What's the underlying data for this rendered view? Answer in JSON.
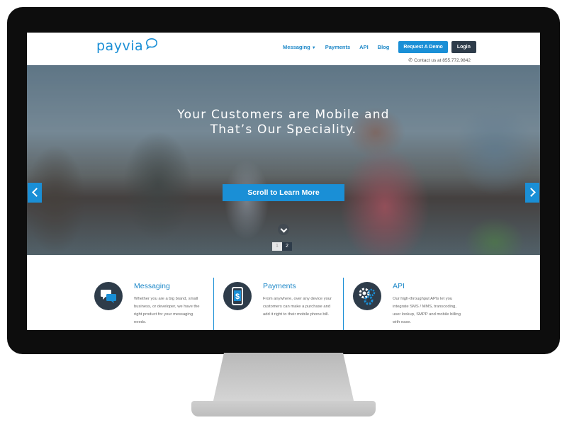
{
  "brand": {
    "logo_text": "payvia",
    "accent": "#1a8fd6",
    "dark": "#2e3c4a"
  },
  "nav": {
    "items": [
      {
        "label": "Messaging",
        "has_dropdown": true
      },
      {
        "label": "Payments"
      },
      {
        "label": "API"
      },
      {
        "label": "Blog"
      }
    ],
    "demo_button": "Request A Demo",
    "login_button": "Login"
  },
  "contact": {
    "text": "Contact us at 855.772.9842",
    "icon": "phone-icon"
  },
  "hero": {
    "title_line1": "Your Customers are Mobile and",
    "title_line2": "That’s Our Speciality.",
    "cta": "Scroll to Learn More",
    "pages": [
      "1",
      "2"
    ],
    "active_page": "2"
  },
  "features": [
    {
      "title": "Messaging",
      "icon": "chat-bubbles-icon",
      "text": "Whether you are a big brand, small business, or developer, we have the right product for your messaging needs."
    },
    {
      "title": "Payments",
      "icon": "mobile-dollar-icon",
      "text": "From anywhere, over any device your customers can make a purchase and add it right to their mobile phone bill."
    },
    {
      "title": "API",
      "icon": "gears-icon",
      "text": "Our high-throughput APIs let you integrate SMS / MMS, transcoding, user lookup, SMPP and mobile billing with ease."
    }
  ]
}
